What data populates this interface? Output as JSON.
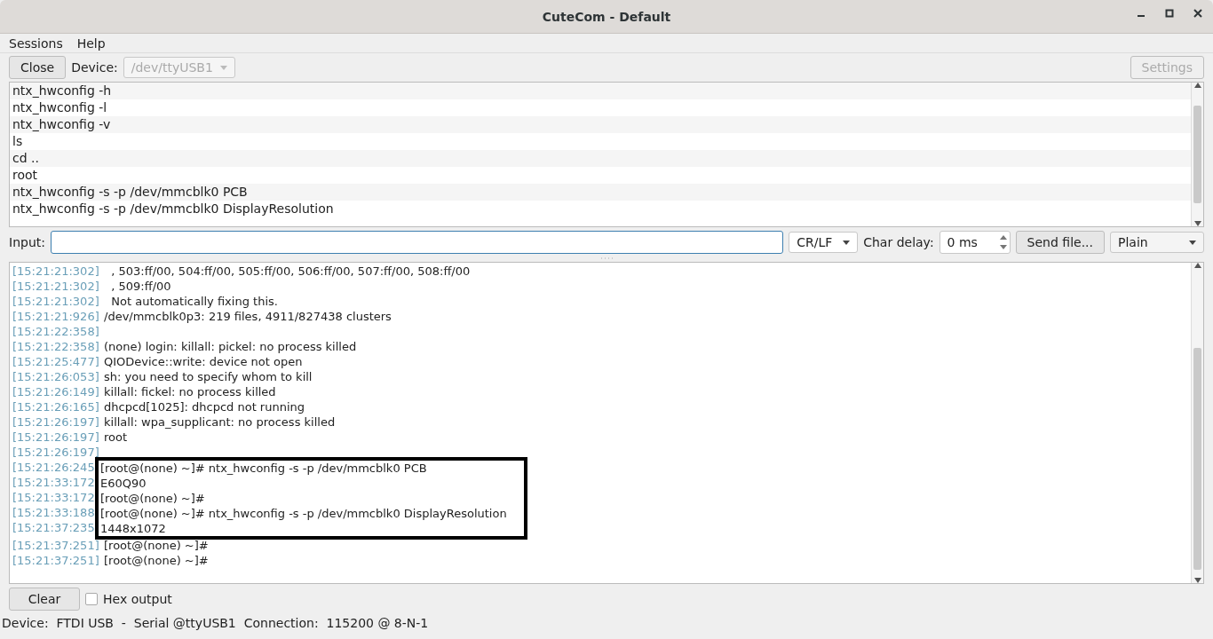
{
  "window": {
    "title": "CuteCom - Default"
  },
  "menu": [
    {
      "label": "Sessions"
    },
    {
      "label": "Help"
    }
  ],
  "toolbar": {
    "close_button": "Close",
    "device_label": "Device:",
    "device_value": "/dev/ttyUSB1",
    "device_disabled": true,
    "settings_button": "Settings",
    "settings_disabled": true
  },
  "history": [
    "ntx_hwconfig -h",
    "ntx_hwconfig -l",
    "ntx_hwconfig -v",
    "ls",
    "cd ..",
    "root",
    "ntx_hwconfig -s -p /dev/mmcblk0 PCB",
    "ntx_hwconfig -s -p /dev/mmcblk0 DisplayResolution"
  ],
  "input_row": {
    "label": "Input:",
    "line_end": "CR/LF",
    "char_delay_label": "Char delay:",
    "char_delay": "0 ms",
    "send_file": "Send file...",
    "mode": "Plain"
  },
  "log": [
    {
      "time": "[15:21:21:302]",
      "text": "  , 503:ff/00, 504:ff/00, 505:ff/00, 506:ff/00, 507:ff/00, 508:ff/00",
      "framed": false
    },
    {
      "time": "[15:21:21:302]",
      "text": "  , 509:ff/00",
      "framed": false
    },
    {
      "time": "[15:21:21:302]",
      "text": "  Not automatically fixing this.",
      "framed": false
    },
    {
      "time": "[15:21:21:926]",
      "text": "/dev/mmcblk0p3: 219 files, 4911/827438 clusters",
      "framed": false
    },
    {
      "time": "[15:21:22:358]",
      "framed": false
    },
    {
      "time": "[15:21:22:358]",
      "text": "(none) login: killall: pickel: no process killed",
      "framed": false
    },
    {
      "time": "[15:21:25:477]",
      "text": "QIODevice::write: device not open",
      "framed": false
    },
    {
      "time": "[15:21:26:053]",
      "text": "sh: you need to specify whom to kill",
      "framed": false
    },
    {
      "time": "[15:21:26:149]",
      "text": "killall: fickel: no process killed",
      "framed": false
    },
    {
      "time": "[15:21:26:165]",
      "text": "dhcpcd[1025]: dhcpcd not running",
      "framed": false
    },
    {
      "time": "[15:21:26:197]",
      "text": "killall: wpa_supplicant: no process killed",
      "framed": false
    },
    {
      "time": "[15:21:26:197]",
      "text": "root",
      "framed": false
    },
    {
      "time": "[15:21:26:197]",
      "framed": false
    },
    {
      "time": "[15:21:26:245",
      "text": "[root@(none) ~]# ntx_hwconfig -s -p /dev/mmcblk0 PCB",
      "framed": true
    },
    {
      "time": "[15:21:33:172",
      "text": "E60Q90",
      "framed": true
    },
    {
      "time": "[15:21:33:172",
      "text": "[root@(none) ~]#",
      "framed": true
    },
    {
      "time": "[15:21:33:188",
      "text": "[root@(none) ~]# ntx_hwconfig -s -p /dev/mmcblk0 DisplayResolution",
      "framed": true
    },
    {
      "time": "[15:21:37:235",
      "text": "1448x1072",
      "framed": true
    },
    {
      "time": "[15:21:37:251]",
      "text": "[root@(none) ~]#",
      "framed": false
    },
    {
      "time": "[15:21:37:251]",
      "text": "[root@(none) ~]#",
      "framed": false
    }
  ],
  "bottom": {
    "clear_button": "Clear",
    "hex_output": {
      "label": "Hex output",
      "checked": false
    }
  },
  "status_bar": "Device:  FTDI USB  -  Serial @ttyUSB1  Connection:  115200 @ 8-N-1"
}
